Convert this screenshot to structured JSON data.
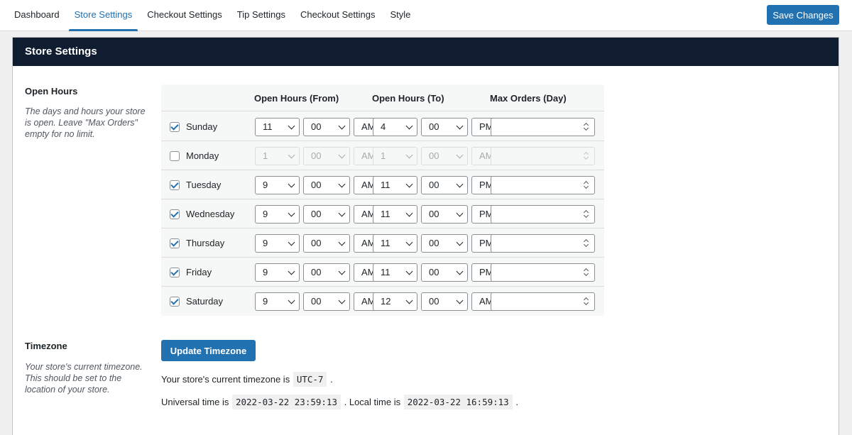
{
  "tabs": [
    {
      "label": "Dashboard",
      "active": false
    },
    {
      "label": "Store Settings",
      "active": true
    },
    {
      "label": "Checkout Settings",
      "active": false
    },
    {
      "label": "Tip Settings",
      "active": false
    },
    {
      "label": "Checkout Settings",
      "active": false
    },
    {
      "label": "Style",
      "active": false
    }
  ],
  "save_button": "Save Changes",
  "panel_title": "Store Settings",
  "open_hours": {
    "label": "Open Hours",
    "description": "The days and hours your store is open. Leave \"Max Orders\" empty for no limit.",
    "headers": {
      "from": "Open Hours (From)",
      "to": "Open Hours (To)",
      "max": "Max Orders (Day)"
    },
    "days": [
      {
        "name": "Sunday",
        "checked": true,
        "from_hour": "11",
        "from_min": "00",
        "from_ampm": "AM",
        "to_hour": "4",
        "to_min": "00",
        "to_ampm": "PM",
        "max": ""
      },
      {
        "name": "Monday",
        "checked": false,
        "from_hour": "1",
        "from_min": "00",
        "from_ampm": "AM",
        "to_hour": "1",
        "to_min": "00",
        "to_ampm": "AM",
        "max": ""
      },
      {
        "name": "Tuesday",
        "checked": true,
        "from_hour": "9",
        "from_min": "00",
        "from_ampm": "AM",
        "to_hour": "11",
        "to_min": "00",
        "to_ampm": "PM",
        "max": ""
      },
      {
        "name": "Wednesday",
        "checked": true,
        "from_hour": "9",
        "from_min": "00",
        "from_ampm": "AM",
        "to_hour": "11",
        "to_min": "00",
        "to_ampm": "PM",
        "max": ""
      },
      {
        "name": "Thursday",
        "checked": true,
        "from_hour": "9",
        "from_min": "00",
        "from_ampm": "AM",
        "to_hour": "11",
        "to_min": "00",
        "to_ampm": "PM",
        "max": ""
      },
      {
        "name": "Friday",
        "checked": true,
        "from_hour": "9",
        "from_min": "00",
        "from_ampm": "AM",
        "to_hour": "11",
        "to_min": "00",
        "to_ampm": "PM",
        "max": ""
      },
      {
        "name": "Saturday",
        "checked": true,
        "from_hour": "9",
        "from_min": "00",
        "from_ampm": "AM",
        "to_hour": "12",
        "to_min": "00",
        "to_ampm": "AM",
        "max": ""
      }
    ]
  },
  "timezone": {
    "label": "Timezone",
    "description": "Your store's current timezone. This should be set to the location of your store.",
    "button": "Update Timezone",
    "current_prefix": "Your store's current timezone is",
    "current_value": "UTC-7",
    "utc_prefix": "Universal time is",
    "utc_value": "2022-03-22 23:59:13",
    "local_prefix": ". Local time is",
    "local_value": "2022-03-22 16:59:13",
    "period": "."
  },
  "colors": {
    "accent": "#2271b1",
    "header": "#101d30"
  }
}
